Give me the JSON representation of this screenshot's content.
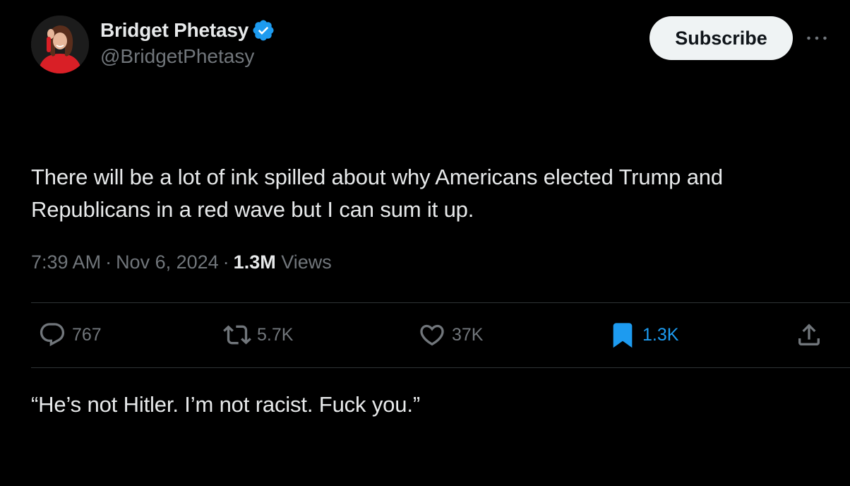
{
  "author": {
    "display_name": "Bridget Phetasy",
    "handle": "@BridgetPhetasy",
    "verified": true,
    "avatar_icon": "profile-photo"
  },
  "header": {
    "subscribe_label": "Subscribe",
    "more_icon": "more-horizontal-icon"
  },
  "tweet": {
    "paragraphs": [
      "There will be a lot of ink spilled about why Americans elected Trump and Republicans in a red wave but I can sum it up.",
      "“He’s not Hitler. I’m not racist. Fuck you.”"
    ]
  },
  "meta": {
    "time": "7:39 AM",
    "separator": "·",
    "date": "Nov 6, 2024",
    "views_count": "1.3M",
    "views_label": "Views"
  },
  "actions": {
    "replies": "767",
    "reposts": "5.7K",
    "likes": "37K",
    "bookmarks": "1.3K"
  },
  "colors": {
    "background": "#000000",
    "primary_text": "#e7e9ea",
    "secondary_text": "#71767b",
    "accent_blue": "#1d9bf0",
    "divider": "#2f3336",
    "subscribe_bg": "#eff3f4"
  }
}
